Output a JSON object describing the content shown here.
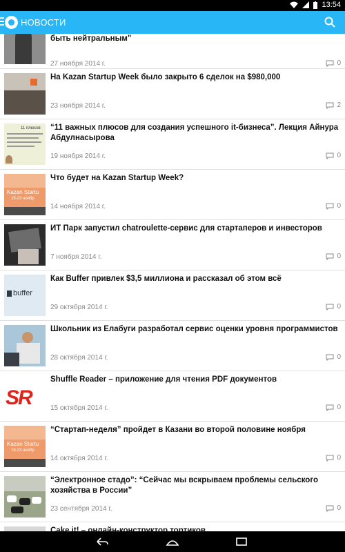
{
  "status": {
    "time": "13:54"
  },
  "appbar": {
    "title": "НОВОСТИ"
  },
  "news": [
    {
      "title": "быть нейтральным\"",
      "date": "27 ноября 2014 г.",
      "comments": "0"
    },
    {
      "title": "На Kazan Startup Week было закрыто 6 сделок на $980,000",
      "date": "23 ноября 2014 г.",
      "comments": "2"
    },
    {
      "title": "“11 важных плюсов для создания успешного it-бизнеса”. Лекция Айнура Абдулнасырова",
      "date": "19 ноября 2014 г.",
      "comments": "0",
      "thumb_text": "11 плюсов"
    },
    {
      "title": "Что будет на Kazan Startup Week?",
      "date": "14 ноября 2014 г.",
      "comments": "0",
      "thumb_text": "Kazan Startu",
      "thumb_sub": "15-23 ноябр"
    },
    {
      "title": "ИТ Парк запустил chatroulette-сервис для стартаперов и инвесторов",
      "date": "7 ноября 2014 г.",
      "comments": "0"
    },
    {
      "title": "Как Buffer привлек $3,5 миллиона и рассказал об этом всё",
      "date": "29 октября 2014 г.",
      "comments": "0",
      "thumb_text": "buffer"
    },
    {
      "title": "Школьник из Елабуги разработал сервис оценки уровня программистов",
      "date": "28 октября 2014 г.",
      "comments": "0"
    },
    {
      "title": "Shuffle Reader – приложение для чтения PDF документов",
      "date": "15 октября 2014 г.",
      "comments": "0",
      "thumb_text": "SR"
    },
    {
      "title": "“Стартап-неделя” пройдет в Казани во второй половине ноября",
      "date": "14 октября 2014 г.",
      "comments": "0",
      "thumb_text": "Kazan Startu",
      "thumb_sub": "15-23 ноябр"
    },
    {
      "title": "“Электронное стадо”: “Сейчас мы вскрываем проблемы сельского хозяйства в России”",
      "date": "23 сентября 2014 г.",
      "comments": "0"
    },
    {
      "title": "Cake it! – онлайн-конструктор тортиков",
      "date": "",
      "comments": ""
    }
  ]
}
